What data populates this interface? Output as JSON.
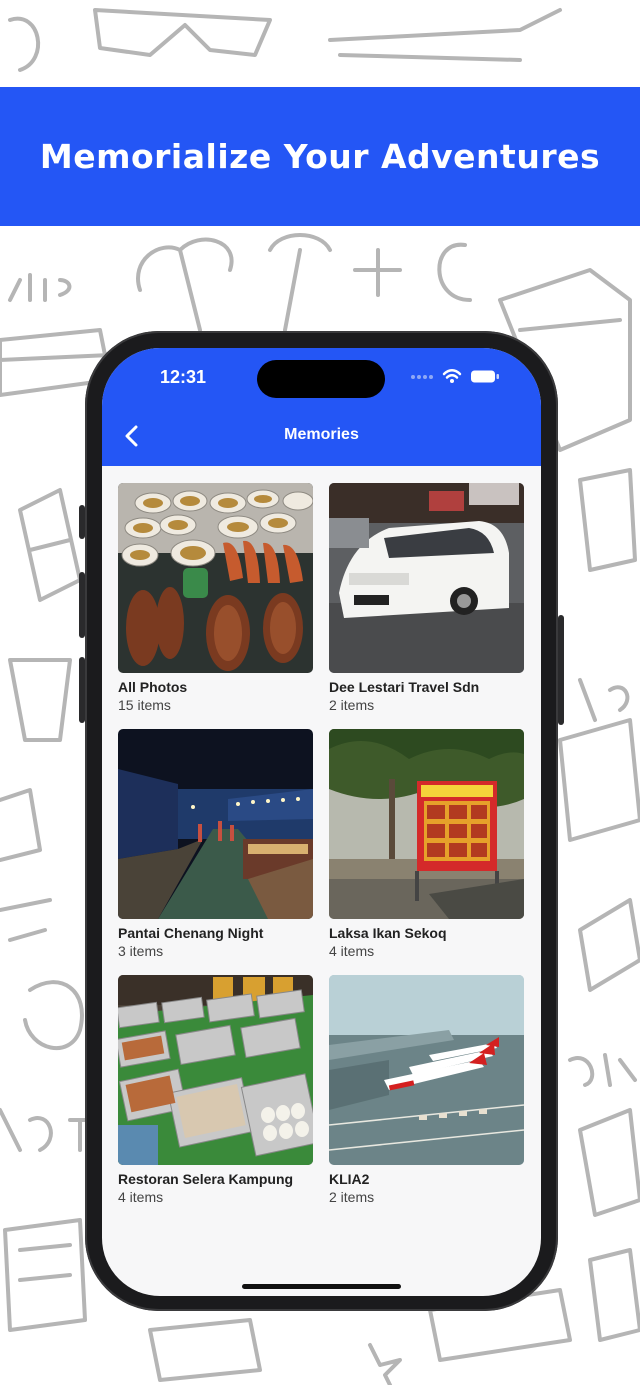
{
  "banner": {
    "title": "Memorialize Your Adventures"
  },
  "status_bar": {
    "time": "12:31",
    "icons": [
      "signal-icon",
      "wifi-icon",
      "battery-icon"
    ]
  },
  "nav": {
    "title": "Memories",
    "back_icon": "chevron-left-icon"
  },
  "colors": {
    "brand_blue": "#2456f5",
    "background": "#f7f7f8"
  },
  "albums": [
    {
      "name": "All Photos",
      "count": "15 items"
    },
    {
      "name": "Dee Lestari Travel Sdn",
      "count": "2 items"
    },
    {
      "name": "Pantai Chenang Night",
      "count": "3 items"
    },
    {
      "name": "Laksa Ikan Sekoq",
      "count": "4 items"
    },
    {
      "name": "Restoran Selera Kampung",
      "count": "4 items"
    },
    {
      "name": "KLIA2",
      "count": "2 items"
    }
  ]
}
